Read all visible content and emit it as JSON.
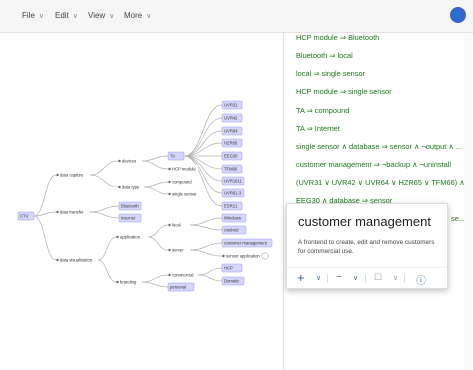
{
  "menubar": {
    "items": [
      {
        "label": "File"
      },
      {
        "label": "Edit"
      },
      {
        "label": "View"
      },
      {
        "label": "More"
      }
    ],
    "avatar_glyph": "👤"
  },
  "tree": {
    "root": "CTV",
    "nodes": {
      "data_capture": "data capture",
      "data_transfer": "data transfer",
      "data_visualization": "data visualization",
      "devices": "devices",
      "data_type": "data type",
      "bluetooth": "Bluetooth",
      "internet": "Internet",
      "application": "application",
      "server": "server",
      "branding": "branding",
      "ta": "TA",
      "hcp_module": "HCP module",
      "compound": "compound",
      "single_sensor": "single sensor",
      "uvr31": "UVR31",
      "uvr42": "UVR42",
      "uvr64": "UVR64",
      "hzr65": "HZR65",
      "eeg30": "EEG30",
      "tfm66": "TFM66",
      "uvr1611": "UVR1611",
      "uvr61_3": "UVR61-3",
      "esr21": "ESR21",
      "local": "local",
      "windows": "Windows",
      "android": "Android",
      "customer_management": "customer management",
      "sensor_application": "sensor application",
      "hcp": "HCP",
      "commercial": "commercial",
      "personal": "personal",
      "dometic": "Dometic"
    }
  },
  "rules": [
    "HCP module ⇒ Bluetooth",
    "Bluetooth ⇒ local",
    "local ⇒ single sensor",
    "HCP module ⇒ single sensor",
    "TA ⇒ compound",
    "TA ⇒ Internet",
    "single sensor ∧ database ⇒ sensor ∧ ¬output ∧ ...",
    "customer management ⇒ ¬backup ∧ ¬uninstall",
    "(UVR31 ∨ UVR42 ∨ UVR64 ∨ HZR65 ∨ TFM66) ∧...",
    "EEG30 ∧ database ⇒ sensor",
    "se..."
  ],
  "card": {
    "title": "customer management",
    "description": "A frontend to create, edit and remove customers for commercial use.",
    "tools": {
      "add": "+",
      "remove": "−",
      "box": "☐",
      "info": "ⓘ",
      "chevron": "∨"
    }
  },
  "colors": {
    "accent": "#3e63c8",
    "rule_text": "#1a7a1a",
    "node_fill": "#d6d6fb",
    "node_border": "#9c9cf0",
    "edge": "#b0b0b0"
  }
}
